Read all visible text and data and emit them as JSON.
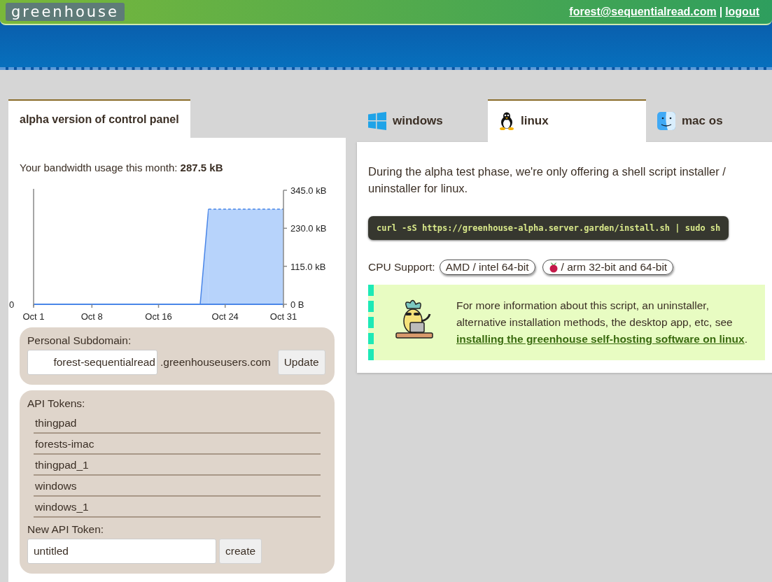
{
  "header": {
    "logo": "greenhouse",
    "user_email": "forest@sequentialread.com",
    "separator": "|",
    "logout": "logout"
  },
  "control_panel": {
    "tab": "alpha version of control panel",
    "bandwidth_text": "Your bandwidth usage this month: **287.5 kB**",
    "left_tick_label": "0",
    "chart_data": {
      "type": "area",
      "categories": [
        "Oct 1",
        null,
        null,
        null,
        null,
        null,
        null,
        "Oct 8",
        null,
        null,
        null,
        null,
        null,
        null,
        null,
        "Oct 16",
        null,
        null,
        null,
        null,
        null,
        null,
        null,
        "Oct 24",
        null,
        null,
        null,
        null,
        null,
        null,
        "Oct 31"
      ],
      "ylim": [
        0,
        345
      ],
      "series": [
        {
          "color": "#4a86e8",
          "values": [
            0,
            0,
            0,
            0,
            0,
            0,
            0,
            0,
            0,
            0,
            0,
            0,
            0,
            0,
            0,
            0,
            0,
            0,
            0,
            0,
            0,
            288,
            null,
            null,
            null,
            null,
            null,
            null,
            null,
            null,
            null
          ]
        },
        {
          "color": "#4a86e8",
          "values": [
            null,
            null,
            null,
            null,
            null,
            null,
            null,
            null,
            null,
            null,
            null,
            null,
            null,
            null,
            null,
            null,
            null,
            null,
            null,
            null,
            null,
            288,
            288,
            288,
            288,
            288,
            288,
            288,
            288,
            288,
            288
          ]
        }
      ],
      "yticks": [
        {
          "value": 0,
          "label": "0 B"
        },
        {
          "value": 115,
          "label": "115.0 kB"
        },
        {
          "value": 230,
          "label": "230.0 kB"
        },
        {
          "value": 345,
          "label": "345.0 kB"
        }
      ]
    },
    "subdomain": {
      "label": "Personal Subdomain:",
      "value": "forest-sequentialread",
      "suffix": ".greenhouseusers.com",
      "button": "Update"
    },
    "api_tokens": {
      "label": "API Tokens:",
      "items": [
        "thingpad",
        "forests-imac",
        "thingpad_1",
        "windows",
        "windows_1"
      ],
      "new_label": "New API Token:",
      "new_value": "untitled",
      "button": "create"
    }
  },
  "install": {
    "tabs": [
      {
        "label": "windows",
        "selected": false
      },
      {
        "label": "linux",
        "selected": true
      },
      {
        "label": "mac os",
        "selected": false
      }
    ],
    "intro": "During the alpha test phase, we're only offering a shell script installer / uninstaller for linux.",
    "command": "curl -sS https://greenhouse-alpha.server.garden/install.sh | sudo sh",
    "cpu_label": "CPU Support:",
    "cpu_badges": [
      "AMD / intel 64-bit",
      "/ arm 32-bit and 64-bit"
    ],
    "info_text": "For more information about this script, an uninstaller, alternative installation methods, the desktop app, etc, see",
    "info_link": "installing the greenhouse self-hosting software on linux",
    "info_end": "."
  }
}
